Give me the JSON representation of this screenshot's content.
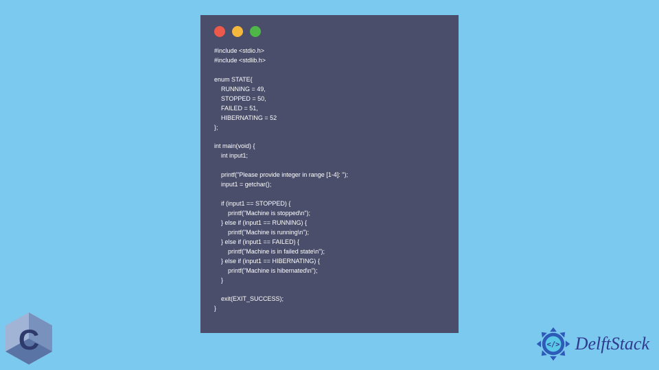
{
  "code": {
    "lines": [
      "#include <stdio.h>",
      "#include <stdlib.h>",
      "",
      "enum STATE{",
      "    RUNNING = 49,",
      "    STOPPED = 50,",
      "    FAILED = 51,",
      "    HIBERNATING = 52",
      "};",
      "",
      "int main(void) {",
      "    int input1;",
      "",
      "    printf(\"Please provide integer in range [1-4]: \");",
      "    input1 = getchar();",
      "",
      "    if (input1 == STOPPED) {",
      "        printf(\"Machine is stopped\\n\");",
      "    } else if (input1 == RUNNING) {",
      "        printf(\"Machine is running\\n\");",
      "    } else if (input1 == FAILED) {",
      "        printf(\"Machine is in failed state\\n\");",
      "    } else if (input1 == HIBERNATING) {",
      "        printf(\"Machine is hibernated\\n\");",
      "    }",
      "",
      "    exit(EXIT_SUCCESS);",
      "}"
    ]
  },
  "brand": {
    "name": "DelftStack"
  },
  "colors": {
    "background": "#7cc9ef",
    "window": "#4a4e6a",
    "red": "#ed594a",
    "yellow": "#f4b83d",
    "green": "#4fb748",
    "brand_text": "#2f3a8f"
  }
}
